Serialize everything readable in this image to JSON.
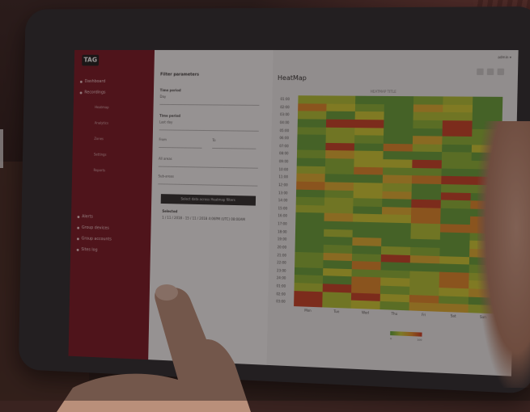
{
  "app": {
    "logo": "TAG",
    "user": "admin ▾",
    "title": "HeatMap",
    "caption": "HEATMAP TITLE"
  },
  "sidebar": {
    "items": [
      {
        "label": "Dashboard"
      },
      {
        "label": "Recordings"
      }
    ],
    "sub_items": [
      "Heatmap",
      "Analytics",
      "Zones",
      "Settings",
      "Reports"
    ],
    "lower_items": [
      {
        "label": "Alerts"
      },
      {
        "label": "Group devices"
      },
      {
        "label": "Group accounts"
      },
      {
        "label": "Sites log"
      }
    ]
  },
  "panel": {
    "title": "Filter parameters",
    "time_label": "Time period",
    "time_value": "Day",
    "period_label": "Time period",
    "period_value": "Last day",
    "from_placeholder": "From",
    "to_placeholder": "To",
    "group_placeholder": "All areas",
    "filter_placeholder": "Sub-areas",
    "select_button": "Select data across Heatmap filters",
    "selected_label": "Selected",
    "selected_value": "1 / 11 / 2018 - 15 / 11 / 2018 4:06PM (UTC) 08:00AM"
  },
  "heatmap": {
    "rows": 27,
    "cols": 7,
    "y_labels": [
      "01:00",
      "02:00",
      "03:00",
      "04:00",
      "05:00",
      "06:00",
      "07:00",
      "08:00",
      "09:00",
      "10:00",
      "11:00",
      "12:00",
      "13:00",
      "14:00",
      "15:00",
      "16:00",
      "17:00",
      "18:00",
      "19:00",
      "20:00",
      "21:00",
      "22:00",
      "23:00",
      "24:00",
      "01:00",
      "02:00",
      "03:00"
    ],
    "x_labels": [
      "Mon",
      "Tue",
      "Wed",
      "Thu",
      "Fri",
      "Sat",
      "Sun"
    ],
    "legend_min": "0",
    "legend_max": "100",
    "palette": [
      "#6aa23d",
      "#8db53a",
      "#b4c337",
      "#cfcb36",
      "#e0b035",
      "#e08a2e",
      "#c9462a"
    ]
  }
}
